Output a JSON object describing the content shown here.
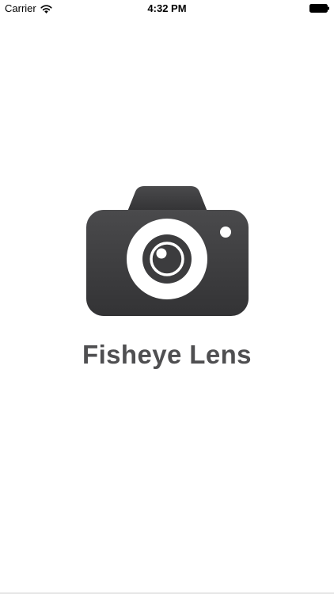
{
  "status_bar": {
    "carrier": "Carrier",
    "time": "4:32 PM",
    "wifi_icon": "wifi-icon",
    "battery_icon": "battery-icon"
  },
  "splash": {
    "logo_icon": "camera-icon",
    "title": "Fisheye Lens"
  },
  "colors": {
    "title": "#4f4f51",
    "camera_body": "#3f3f41",
    "background": "#ffffff"
  }
}
